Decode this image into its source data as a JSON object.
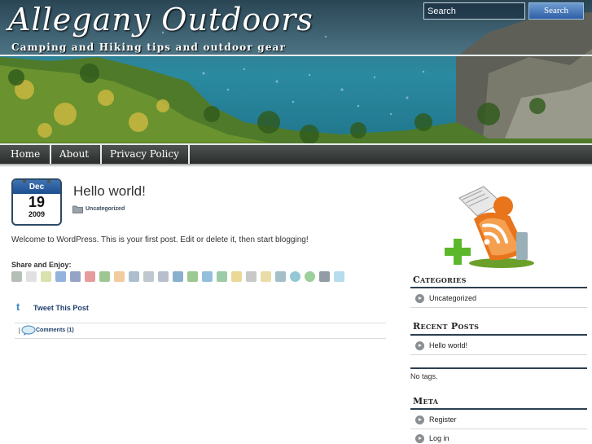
{
  "header": {
    "site_title": "Allegany Outdoors",
    "tagline": "Camping and Hiking tips and outdoor gear",
    "search_placeholder": "Search",
    "search_button": "Search"
  },
  "nav": {
    "items": [
      {
        "label": "Home"
      },
      {
        "label": "About"
      },
      {
        "label": "Privacy Policy"
      }
    ]
  },
  "post": {
    "date": {
      "month": "Dec",
      "day": "19",
      "year": "2009"
    },
    "title": "Hello world!",
    "category": "Uncategorized",
    "body": "Welcome to WordPress. This is your first post. Edit or delete it, then start blogging!",
    "share_label": "Share and Enjoy:",
    "share_icons": [
      "print-icon",
      "digg-icon",
      "sphinn-icon",
      "delicious-icon",
      "facebook-icon",
      "mixx-icon",
      "google-bookmarks-icon",
      "diigo-icon",
      "hyves-icon",
      "email-icon",
      "friendfeed-icon",
      "linkedin-icon",
      "netvibes-icon",
      "blinklist-icon",
      "evernote-icon",
      "faves-icon",
      "design-float-icon",
      "yahoo-buzz-icon",
      "mister-wong-icon",
      "stumbleupon-icon",
      "technorati-icon",
      "tumblr-icon",
      "twitter-icon"
    ],
    "tweet_label": "Tweet This Post",
    "comments_label": "Comments (1)"
  },
  "sidebar": {
    "categories": {
      "title": "Categories",
      "items": [
        "Uncategorized"
      ]
    },
    "recent_posts": {
      "title": "Recent Posts",
      "items": [
        "Hello world!"
      ]
    },
    "tags_text": "No tags.",
    "meta": {
      "title": "Meta",
      "items": [
        "Register",
        "Log in"
      ]
    }
  },
  "colors": {
    "nav_bg": "#3b3f3e",
    "search_button": "#3a6db1",
    "calendar_header": "#2b5fa3",
    "widget_rule": "#2c3f4f",
    "rss_orange": "#e8741c",
    "plus_green": "#5cb82a"
  }
}
